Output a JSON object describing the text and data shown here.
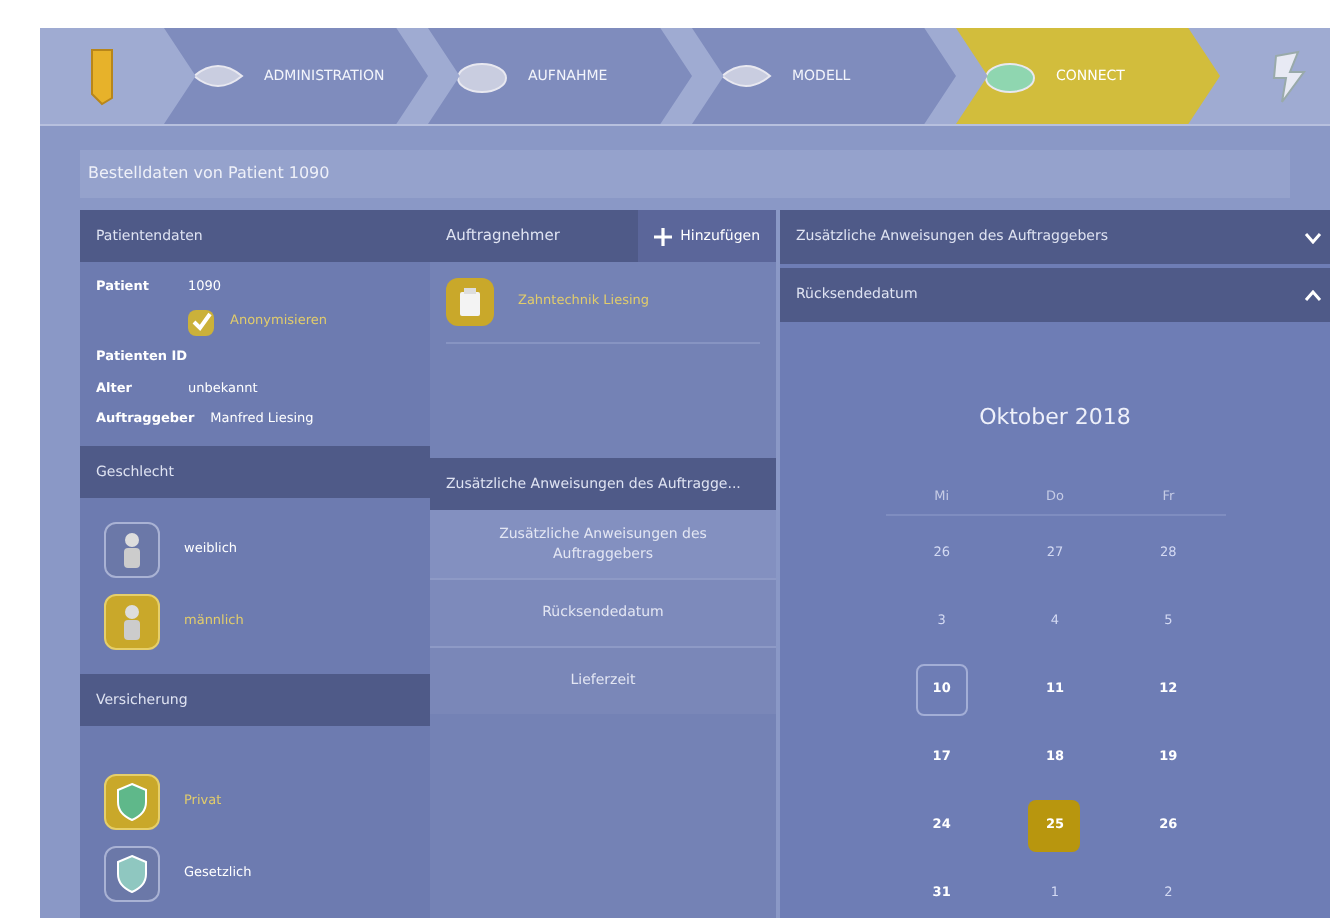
{
  "nav_tabs": [
    {
      "label": "ADMINISTRATION",
      "selected": false
    },
    {
      "label": "AUFNAHME",
      "selected": false
    },
    {
      "label": "MODELL",
      "selected": false
    },
    {
      "label": "CONNECT",
      "selected": true
    }
  ],
  "page_title": "Bestelldaten von Patient 1090",
  "patient_panel": {
    "title": "Patientendaten",
    "patient_label": "Patient",
    "patient_value": "1090",
    "anonymize": {
      "label": "Anonymisieren",
      "checked": true
    },
    "fields": [
      {
        "label": "Patienten ID"
      },
      {
        "label": "Alter",
        "value": "unbekannt"
      },
      {
        "label": "Auftraggeber",
        "value": "Manfred Liesing"
      }
    ]
  },
  "contractor_panel": {
    "title": "Auftragnehmer",
    "add_button": "Hinzufügen",
    "items": [
      {
        "label": "Zahntechnik Liesing",
        "selected": true
      }
    ]
  },
  "gender": {
    "title": "Geschlecht",
    "options": [
      {
        "label": "weiblich",
        "selected": false
      },
      {
        "label": "männlich",
        "selected": true
      }
    ]
  },
  "insurance": {
    "title": "Versicherung",
    "options": [
      {
        "label": "Privat",
        "selected": true
      },
      {
        "label": "Gesetzlich",
        "selected": false
      }
    ]
  },
  "section_nav": {
    "title": "Zusätzliche Anweisungen des Auftragge...",
    "items": [
      "Zusätzliche Anweisungen des Auftraggebers",
      "Rücksendedatum",
      "Lieferzeit"
    ]
  },
  "accordions": [
    {
      "title": "Zusätzliche Anweisungen des Auftraggebers",
      "expanded": false
    },
    {
      "title": "Rücksendedatum",
      "expanded": true
    }
  ],
  "calendar": {
    "month": "Oktober 2018",
    "weekdays": [
      "Mi",
      "Do",
      "Fr"
    ],
    "days": [
      {
        "label": "26",
        "muted": true,
        "today": false,
        "selected": false
      },
      {
        "label": "27",
        "muted": true,
        "today": false,
        "selected": false
      },
      {
        "label": "28",
        "muted": true,
        "today": false,
        "selected": false
      },
      {
        "label": "3",
        "muted": true,
        "today": false,
        "selected": false
      },
      {
        "label": "4",
        "muted": true,
        "today": false,
        "selected": false
      },
      {
        "label": "5",
        "muted": true,
        "today": false,
        "selected": false
      },
      {
        "label": "10",
        "muted": false,
        "today": true,
        "selected": false
      },
      {
        "label": "11",
        "muted": false,
        "today": false,
        "selected": false
      },
      {
        "label": "12",
        "muted": false,
        "today": false,
        "selected": false
      },
      {
        "label": "17",
        "muted": false,
        "today": false,
        "selected": false
      },
      {
        "label": "18",
        "muted": false,
        "today": false,
        "selected": false
      },
      {
        "label": "19",
        "muted": false,
        "today": false,
        "selected": false
      },
      {
        "label": "24",
        "muted": false,
        "today": false,
        "selected": false
      },
      {
        "label": "25",
        "muted": false,
        "today": false,
        "selected": true
      },
      {
        "label": "26",
        "muted": false,
        "today": false,
        "selected": false
      },
      {
        "label": "31",
        "muted": false,
        "today": false,
        "selected": false
      },
      {
        "label": "1",
        "muted": true,
        "today": false,
        "selected": false
      },
      {
        "label": "2",
        "muted": true,
        "today": false,
        "selected": false
      }
    ]
  }
}
